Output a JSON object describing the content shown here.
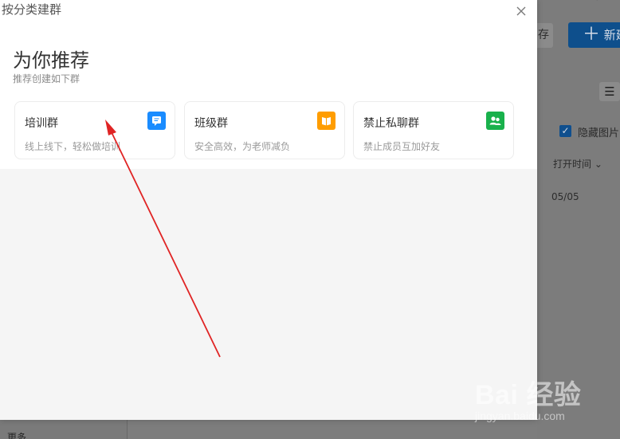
{
  "dialog": {
    "title": "按分类建群",
    "heading": "为你推荐",
    "subheading": "推荐创建如下群",
    "cards": [
      {
        "title": "培训群",
        "description": "线上线下，轻松做培训",
        "icon": "chat-icon",
        "color": "#1a8cff"
      },
      {
        "title": "班级群",
        "description": "安全高效，为老师减负",
        "icon": "book-icon",
        "color": "#ff9d00"
      },
      {
        "title": "禁止私聊群",
        "description": "禁止成员互加好友",
        "icon": "users-icon",
        "color": "#19b14c"
      }
    ]
  },
  "background": {
    "small_button_label": "存",
    "new_button_label": "新建",
    "hide_pictures_label": "隐藏图片",
    "sort_label": "打开时间",
    "date_text": "05/05",
    "bottom_left_text": "更多",
    "top_glyph": "✦"
  },
  "watermark": {
    "main": "Bai 经验",
    "sub": "jingyan.baidu.com"
  },
  "colors": {
    "accent_blue": "#1a8cff",
    "accent_orange": "#ff9d00",
    "accent_green": "#19b14c",
    "arrow_red": "#e02424"
  }
}
